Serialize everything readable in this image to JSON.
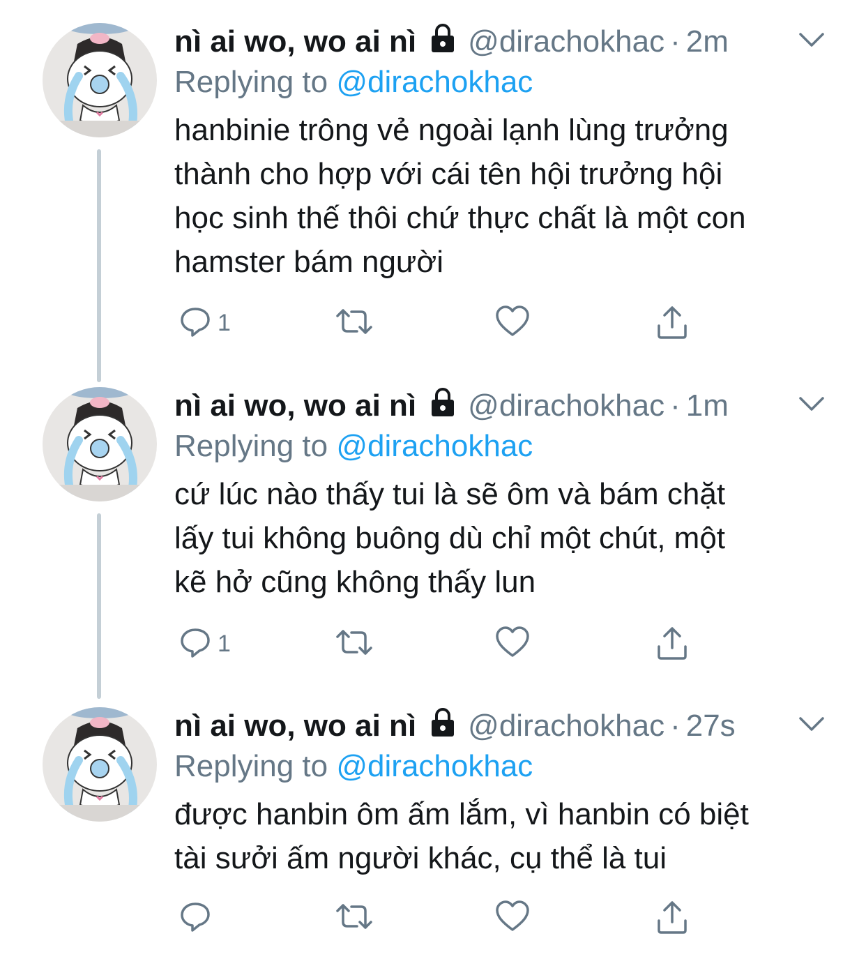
{
  "tweets": [
    {
      "name": "nì ai wo, wo ai nì",
      "handle": "@dirachokhac",
      "separator": "·",
      "time": "2m",
      "replying_prefix": "Replying to",
      "replying_to": "@dirachokhac",
      "lines": [
        "hanbinie trông vẻ ngoài lạnh lùng trưởng",
        "thành cho hợp với cái tên hội trưởng hội",
        "học sinh thế thôi chứ thực chất là một con",
        "hamster bám người"
      ],
      "reply_count": "1"
    },
    {
      "name": "nì ai wo, wo ai nì",
      "handle": "@dirachokhac",
      "separator": "·",
      "time": "1m",
      "replying_prefix": "Replying to",
      "replying_to": "@dirachokhac",
      "lines": [
        "cứ lúc nào thấy tui là sẽ ôm và bám chặt",
        "lấy tui không buông dù chỉ một chút, một",
        "kẽ hở cũng không thấy lun"
      ],
      "reply_count": "1"
    },
    {
      "name": "nì ai wo, wo ai nì",
      "handle": "@dirachokhac",
      "separator": "·",
      "time": "27s",
      "replying_prefix": "Replying to",
      "replying_to": "@dirachokhac",
      "lines": [
        "được hanbin ôm ấm lắm, vì hanbin có biệt",
        "tài sưởi ấm người khác, cụ thể là tui"
      ],
      "reply_count": ""
    }
  ],
  "icons": {
    "lock": "lock-icon",
    "chevron": "chevron-down-icon",
    "reply": "reply-icon",
    "retweet": "retweet-icon",
    "like": "heart-icon",
    "share": "share-icon",
    "avatar": "crying-panda-avatar"
  },
  "colors": {
    "text": "#14171a",
    "secondary": "#657786",
    "link": "#1da1f2",
    "thread_line": "#c4cfd6"
  }
}
